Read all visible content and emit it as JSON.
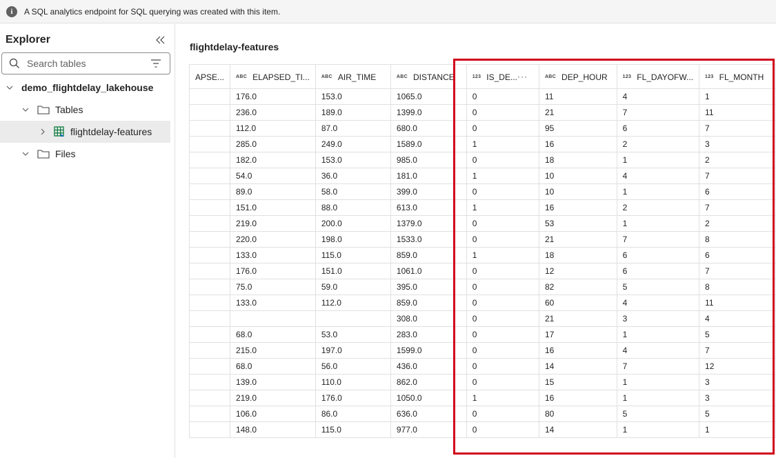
{
  "banner": {
    "icon": "info-icon",
    "text": "A SQL analytics endpoint for SQL querying was created with this item."
  },
  "sidebar": {
    "title": "Explorer",
    "search_placeholder": "Search tables",
    "lakehouse": "demo_flightdelay_lakehouse",
    "tables_folder": "Tables",
    "table_item": "flightdelay-features",
    "files_folder": "Files"
  },
  "main": {
    "table_title": "flightdelay-features",
    "columns": [
      {
        "label": "APSE...",
        "type": ""
      },
      {
        "label": "ELAPSED_TI...",
        "type": "ABC"
      },
      {
        "label": "AIR_TIME",
        "type": "ABC"
      },
      {
        "label": "DISTANCE",
        "type": "ABC"
      },
      {
        "label": "IS_DE...",
        "type": "123"
      },
      {
        "label": "DEP_HOUR",
        "type": "ABC"
      },
      {
        "label": "FL_DAYOFW...",
        "type": "123"
      },
      {
        "label": "FL_MONTH",
        "type": "123"
      }
    ],
    "more_label": "···",
    "rows": [
      [
        "",
        "176.0",
        "153.0",
        "1065.0",
        "0",
        "11",
        "4",
        "1"
      ],
      [
        "",
        "236.0",
        "189.0",
        "1399.0",
        "0",
        "21",
        "7",
        "11"
      ],
      [
        "",
        "112.0",
        "87.0",
        "680.0",
        "0",
        "95",
        "6",
        "7"
      ],
      [
        "",
        "285.0",
        "249.0",
        "1589.0",
        "1",
        "16",
        "2",
        "3"
      ],
      [
        "",
        "182.0",
        "153.0",
        "985.0",
        "0",
        "18",
        "1",
        "2"
      ],
      [
        "",
        "54.0",
        "36.0",
        "181.0",
        "1",
        "10",
        "4",
        "7"
      ],
      [
        "",
        "89.0",
        "58.0",
        "399.0",
        "0",
        "10",
        "1",
        "6"
      ],
      [
        "",
        "151.0",
        "88.0",
        "613.0",
        "1",
        "16",
        "2",
        "7"
      ],
      [
        "",
        "219.0",
        "200.0",
        "1379.0",
        "0",
        "53",
        "1",
        "2"
      ],
      [
        "",
        "220.0",
        "198.0",
        "1533.0",
        "0",
        "21",
        "7",
        "8"
      ],
      [
        "",
        "133.0",
        "115.0",
        "859.0",
        "1",
        "18",
        "6",
        "6"
      ],
      [
        "",
        "176.0",
        "151.0",
        "1061.0",
        "0",
        "12",
        "6",
        "7"
      ],
      [
        "",
        "75.0",
        "59.0",
        "395.0",
        "0",
        "82",
        "5",
        "8"
      ],
      [
        "",
        "133.0",
        "112.0",
        "859.0",
        "0",
        "60",
        "4",
        "11"
      ],
      [
        "",
        "",
        "",
        "308.0",
        "0",
        "21",
        "3",
        "4"
      ],
      [
        "",
        "68.0",
        "53.0",
        "283.0",
        "0",
        "17",
        "1",
        "5"
      ],
      [
        "",
        "215.0",
        "197.0",
        "1599.0",
        "0",
        "16",
        "4",
        "7"
      ],
      [
        "",
        "68.0",
        "56.0",
        "436.0",
        "0",
        "14",
        "7",
        "12"
      ],
      [
        "",
        "139.0",
        "110.0",
        "862.0",
        "0",
        "15",
        "1",
        "3"
      ],
      [
        "",
        "219.0",
        "176.0",
        "1050.0",
        "1",
        "16",
        "1",
        "3"
      ],
      [
        "",
        "106.0",
        "86.0",
        "636.0",
        "0",
        "80",
        "5",
        "5"
      ],
      [
        "",
        "148.0",
        "115.0",
        "977.0",
        "0",
        "14",
        "1",
        "1"
      ]
    ]
  },
  "colors": {
    "highlight": "#d0021b",
    "table_icon": "#107c41"
  }
}
